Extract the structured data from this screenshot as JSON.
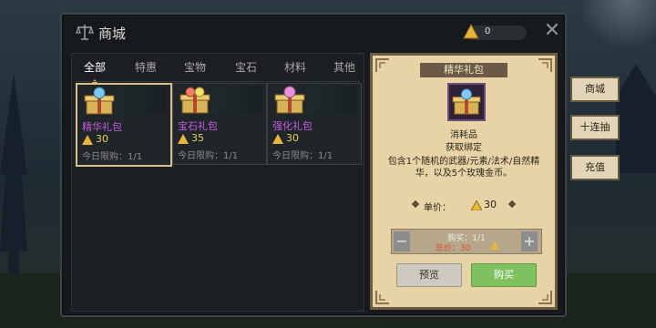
{
  "window": {
    "title": "商城",
    "currency_value": "0"
  },
  "tabs": [
    "全部",
    "特惠",
    "宝物",
    "宝石",
    "材料",
    "其他"
  ],
  "items": [
    {
      "name": "精华礼包",
      "price": "30",
      "limit": "今日限购：1/1",
      "gem_color": "#7ec8f0"
    },
    {
      "name": "宝石礼包",
      "price": "35",
      "limit": "今日限购：1/1",
      "gem_color": "#f0806a"
    },
    {
      "name": "强化礼包",
      "price": "30",
      "limit": "今日限购：1/1",
      "gem_color": "#e894d8"
    }
  ],
  "detail": {
    "title": "精华礼包",
    "type": "消耗品",
    "bind": "获取绑定",
    "description": "包含1个随机的武器/元素/法术/自然精华，以及5个玫瑰金币。",
    "unit_label": "单价：",
    "unit_price": "30",
    "buy_count": "购买：1/1",
    "total": "总价：30",
    "preview_label": "预览",
    "buy_label": "购买"
  },
  "side_buttons": [
    "商城",
    "十连抽",
    "充值"
  ],
  "colors": {
    "item_name": "#c45ae0",
    "price": "#e2d25c",
    "panel_bg": "#e6d4a6",
    "buy_button": "#7fc15e"
  }
}
